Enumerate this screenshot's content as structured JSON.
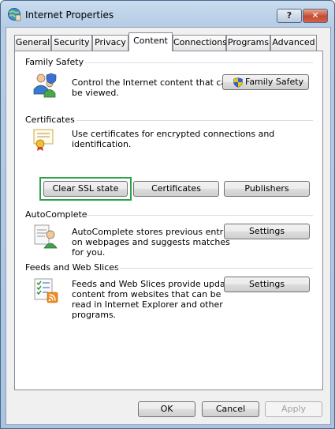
{
  "window": {
    "title": "Internet Properties",
    "help_label": "?",
    "close_label": "✕"
  },
  "tabs": [
    {
      "label": "General"
    },
    {
      "label": "Security"
    },
    {
      "label": "Privacy"
    },
    {
      "label": "Content",
      "active": true
    },
    {
      "label": "Connections"
    },
    {
      "label": "Programs"
    },
    {
      "label": "Advanced"
    }
  ],
  "family_safety": {
    "title": "Family Safety",
    "description_line1": "Control the Internet content that can",
    "description_line2": "be viewed.",
    "button_label": "Family Safety"
  },
  "certificates": {
    "title": "Certificates",
    "description": "Use certificates for encrypted connections and identification.",
    "clear_ssl_label": "Clear SSL state",
    "certificates_label": "Certificates",
    "publishers_label": "Publishers",
    "highlight_color": "#2ca34a"
  },
  "autocomplete": {
    "title": "AutoComplete",
    "line1": "AutoComplete stores previous entries",
    "line2": "on webpages and suggests matches",
    "line3": "for you.",
    "settings_label": "Settings"
  },
  "feeds": {
    "title": "Feeds and Web Slices",
    "line1": "Feeds and Web Slices provide updated",
    "line2": "content from websites that can be",
    "line3": "read in Internet Explorer and other",
    "line4": "programs.",
    "settings_label": "Settings"
  },
  "footer": {
    "ok_label": "OK",
    "cancel_label": "Cancel",
    "apply_label": "Apply"
  },
  "icons": {
    "title": "internet-globe-icon",
    "family_safety": "family-safety-users-icon",
    "shield": "uac-shield-icon",
    "certificate": "certificate-icon",
    "autocomplete": "autocomplete-user-icon",
    "feeds": "feeds-rss-icon"
  }
}
